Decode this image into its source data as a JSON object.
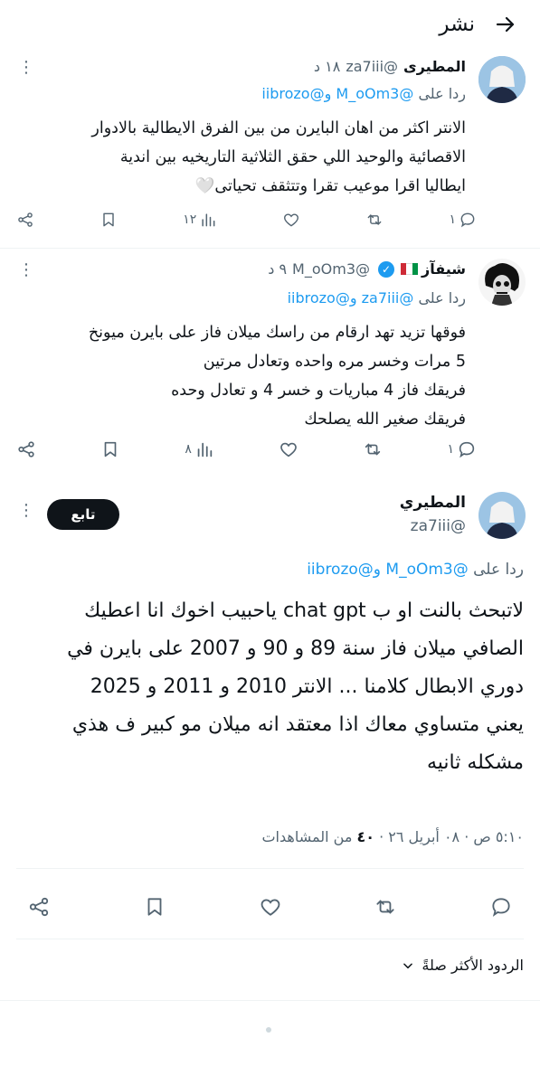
{
  "header": {
    "title": "نشر",
    "back_icon": "arrow-right-icon"
  },
  "replies": [
    {
      "name": "المطيرى",
      "handle": "@za7iii",
      "time": "١٨ د",
      "reply_prefix": "ردا على",
      "reply_mentions": "@M_oOm3 و@iibrozo",
      "body_lines": [
        "الانتر اكثر من اهان البايرن من بين الفرق الايطالية بالادوار",
        "الاقصائية والوحيد اللي حقق الثلاثية التاريخيه بين اندية",
        "ايطاليا اقرا موعيب تقرا وتتثقف تحياتى🤍"
      ],
      "counts": {
        "replies": "١",
        "reposts": "",
        "likes": "",
        "views": "١٢"
      }
    },
    {
      "name": "شيفآز",
      "handle": "@M_oOm3",
      "time": "٩ د",
      "reply_prefix": "ردا على",
      "reply_mentions": "@za7iii و@iibrozo",
      "body_lines": [
        "فوقها تزيد تهد ارقام من راسك ميلان فاز على بايرن ميونخ",
        "5 مرات وخسر مره واحده وتعادل مرتين",
        "فريقك فاز 4 مباريات و خسر 4 و تعادل وحده",
        "فريقك صغير الله يصلحك"
      ],
      "counts": {
        "replies": "١",
        "reposts": "",
        "likes": "",
        "views": "٨"
      }
    }
  ],
  "main": {
    "name": "المطيري",
    "handle": "@za7iii",
    "follow_label": "تابع",
    "reply_prefix": "ردا على",
    "reply_mentions": "@M_oOm3 و@iibrozo",
    "body_lines": [
      "لاتبحث بالنت او ب chat gpt ياحبيب اخوك انا اعطيك",
      "الصافي ميلان فاز سنة 89 و 90 و 2007 على بايرن في",
      "دوري الابطال كلامنا ... الانتر 2010 و 2011 و 2025",
      "يعني متساوي معاك اذا معتقد انه ميلان مو كبير ف هذي",
      "مشكله ثانيه"
    ],
    "time": "٥:١٠ ص",
    "date": "٠٨ أبريل ٢٦",
    "views_count": "٤٠",
    "views_label": "من المشاهدات"
  },
  "sort": {
    "label": "الردود الأكثر صلةً"
  },
  "colors": {
    "accent": "#1d9bf0",
    "text": "#0f1419",
    "muted": "#536471",
    "divider": "#eff3f4"
  }
}
